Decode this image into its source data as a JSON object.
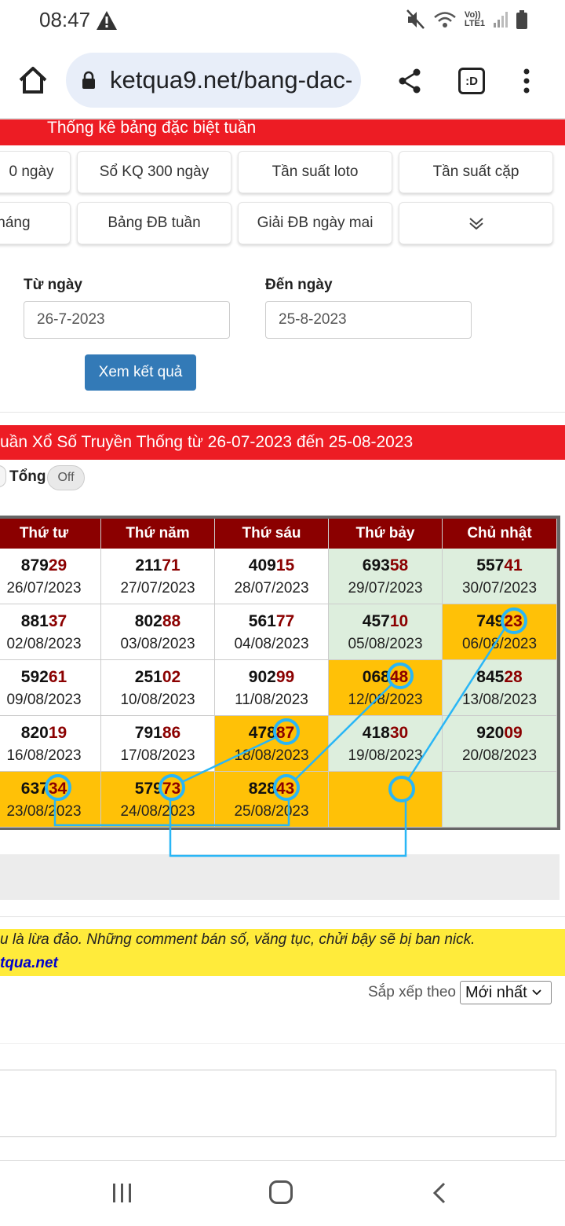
{
  "status_bar": {
    "time": "08:47",
    "lte_label": "LTE1",
    "volte_label": "Vo))"
  },
  "browser": {
    "url": "ketqua9.net/bang-dac-",
    "tab_icon_label": ":D"
  },
  "page_title": "Thống kê bảng đặc biệt tuần",
  "nav_buttons": [
    "0 ngày",
    "Sổ KQ 300 ngày",
    "Tần suất loto",
    "Tần suất cặp",
    " tháng",
    "Bảng ĐB tuần",
    "Giải ĐB ngày mai"
  ],
  "form": {
    "from_label": "Từ ngày",
    "from_value": "26-7-2023",
    "to_label": "Đến ngày",
    "to_value": "25-8-2023",
    "submit_label": "Xem kết quả"
  },
  "results_title": "uần Xổ Số Truyền Thống từ 26-07-2023 đến 25-08-2023",
  "toggle": {
    "label": "Tổng",
    "state": "Off"
  },
  "table": {
    "headers": [
      "Thứ tư",
      "Thứ năm",
      "Thứ sáu",
      "Thứ bảy",
      "Chủ nhật"
    ],
    "rows": [
      [
        {
          "head": "879",
          "tail": "29",
          "date": "26/07/2023",
          "bg": "white"
        },
        {
          "head": "211",
          "tail": "71",
          "date": "27/07/2023",
          "bg": "white"
        },
        {
          "head": "409",
          "tail": "15",
          "date": "28/07/2023",
          "bg": "white"
        },
        {
          "head": "693",
          "tail": "58",
          "date": "29/07/2023",
          "bg": "green"
        },
        {
          "head": "557",
          "tail": "41",
          "date": "30/07/2023",
          "bg": "green"
        }
      ],
      [
        {
          "head": "881",
          "tail": "37",
          "date": "02/08/2023",
          "bg": "white"
        },
        {
          "head": "802",
          "tail": "88",
          "date": "03/08/2023",
          "bg": "white"
        },
        {
          "head": "561",
          "tail": "77",
          "date": "04/08/2023",
          "bg": "white"
        },
        {
          "head": "457",
          "tail": "10",
          "date": "05/08/2023",
          "bg": "green"
        },
        {
          "head": "749",
          "tail": "23",
          "date": "06/08/2023",
          "bg": "orange"
        }
      ],
      [
        {
          "head": "592",
          "tail": "61",
          "date": "09/08/2023",
          "bg": "white"
        },
        {
          "head": "251",
          "tail": "02",
          "date": "10/08/2023",
          "bg": "white"
        },
        {
          "head": "902",
          "tail": "99",
          "date": "11/08/2023",
          "bg": "white"
        },
        {
          "head": "068",
          "tail": "48",
          "date": "12/08/2023",
          "bg": "orange"
        },
        {
          "head": "845",
          "tail": "28",
          "date": "13/08/2023",
          "bg": "green"
        }
      ],
      [
        {
          "head": "820",
          "tail": "19",
          "date": "16/08/2023",
          "bg": "white"
        },
        {
          "head": "791",
          "tail": "86",
          "date": "17/08/2023",
          "bg": "white"
        },
        {
          "head": "478",
          "tail": "87",
          "date": "18/08/2023",
          "bg": "orange"
        },
        {
          "head": "418",
          "tail": "30",
          "date": "19/08/2023",
          "bg": "green"
        },
        {
          "head": "920",
          "tail": "09",
          "date": "20/08/2023",
          "bg": "green"
        }
      ],
      [
        {
          "head": "637",
          "tail": "34",
          "date": "23/08/2023",
          "bg": "orange"
        },
        {
          "head": "579",
          "tail": "73",
          "date": "24/08/2023",
          "bg": "orange"
        },
        {
          "head": "828",
          "tail": "43",
          "date": "25/08/2023",
          "bg": "orange"
        },
        {
          "head": "",
          "tail": "",
          "date": "",
          "bg": "orange"
        },
        {
          "head": "",
          "tail": "",
          "date": "",
          "bg": "green"
        }
      ]
    ]
  },
  "notice": {
    "text": "u là lừa đảo. Những comment bán số, văng tục, chửi bậy sẽ bị ban nick.",
    "link": "tqua.net"
  },
  "sort": {
    "label": "Sắp xếp theo",
    "value": "Mới nhất"
  },
  "colors": {
    "red": "#ed1c24",
    "header": "#8b0000",
    "orange": "#ffc107",
    "green": "#ddeedd",
    "annotation": "#29b6f6",
    "button": "#337ab7"
  }
}
